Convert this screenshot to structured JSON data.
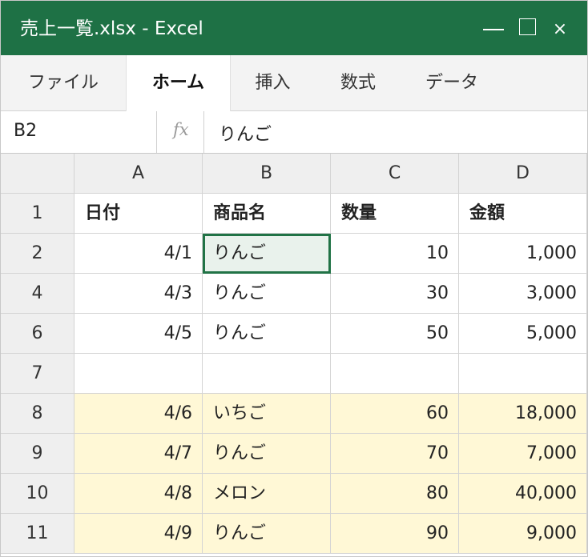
{
  "window": {
    "title": "売上一覧.xlsx - Excel",
    "minimize_glyph": "",
    "close_glyph": "×",
    "accent_color": "#1e7145"
  },
  "ribbon": {
    "tabs": [
      {
        "label": "ファイル",
        "active": false
      },
      {
        "label": "ホーム",
        "active": true
      },
      {
        "label": "挿入",
        "active": false
      },
      {
        "label": "数式",
        "active": false
      },
      {
        "label": "データ",
        "active": false
      }
    ]
  },
  "formula_bar": {
    "name_box": "B2",
    "fx_label": "fx",
    "value": "りんご"
  },
  "sheet": {
    "columns": [
      "A",
      "B",
      "C",
      "D"
    ],
    "selected_cell": "B2",
    "highlight_color": "#fff8d6",
    "rows": [
      {
        "row": "1",
        "cells": [
          "日付",
          "商品名",
          "数量",
          "金額"
        ],
        "header": true,
        "highlight": false
      },
      {
        "row": "2",
        "cells": [
          "4/1",
          "りんご",
          "10",
          "1,000"
        ],
        "header": false,
        "highlight": false
      },
      {
        "row": "4",
        "cells": [
          "4/3",
          "りんご",
          "30",
          "3,000"
        ],
        "header": false,
        "highlight": false
      },
      {
        "row": "6",
        "cells": [
          "4/5",
          "りんご",
          "50",
          "5,000"
        ],
        "header": false,
        "highlight": false
      },
      {
        "row": "7",
        "cells": [
          "",
          "",
          "",
          ""
        ],
        "header": false,
        "highlight": false
      },
      {
        "row": "8",
        "cells": [
          "4/6",
          "いちご",
          "60",
          "18,000"
        ],
        "header": false,
        "highlight": true
      },
      {
        "row": "9",
        "cells": [
          "4/7",
          "りんご",
          "70",
          "7,000"
        ],
        "header": false,
        "highlight": true
      },
      {
        "row": "10",
        "cells": [
          "4/8",
          "メロン",
          "80",
          "40,000"
        ],
        "header": false,
        "highlight": true
      },
      {
        "row": "11",
        "cells": [
          "4/9",
          "りんご",
          "90",
          "9,000"
        ],
        "header": false,
        "highlight": true
      }
    ]
  }
}
